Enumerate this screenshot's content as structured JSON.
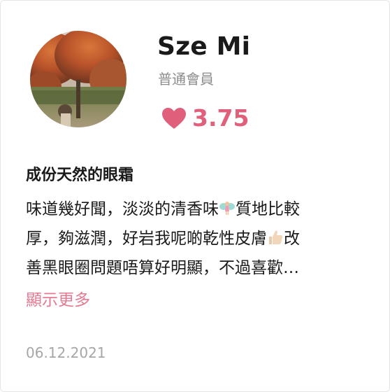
{
  "user": {
    "name": "Sze Mi",
    "member_level": "普通會員",
    "avatar_icon": "avatar-autumn-tree-photo"
  },
  "rating": {
    "value": "3.75",
    "icon": "heart-icon",
    "color": "#e0607c"
  },
  "review": {
    "title": "成份天然的眼霜",
    "lines": [
      {
        "before": "味道幾好聞，淡淡的清香味",
        "emoji": "fairy-emoji",
        "after": "質地比較"
      },
      {
        "before": "厚，夠滋潤，好岩我呢啲乾性皮膚",
        "emoji": "thumbs-up-emoji",
        "after": "改"
      },
      {
        "before": "善黑眼圈問題唔算好明顯，不過喜歡…",
        "emoji": "",
        "after": ""
      }
    ],
    "show_more_label": "顯示更多",
    "date": "06.12.2021"
  },
  "colors": {
    "accent": "#e0607c",
    "link": "#e37a91",
    "muted": "#8c8c8c"
  }
}
